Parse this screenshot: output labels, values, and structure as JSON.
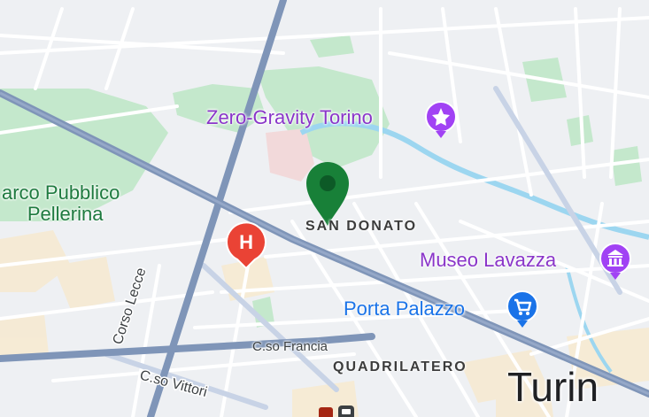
{
  "map": {
    "labels": {
      "park": "arco Pubblico\nPellerina",
      "park_line1": "arco Pubblico",
      "park_line2": "Pellerina",
      "zero_gravity": "Zero-Gravity Torino",
      "san_donato": "SAN DONATO",
      "museo": "Museo Lavazza",
      "porta": "Porta Palazzo",
      "corso_lecce": "Corso Lecce",
      "cso_francia": "C.so Francia",
      "quadrilatero": "QUADRILATERO",
      "cso_vittorio": "C.so Vittori",
      "turin": "Turin",
      "hospital_letter": "H"
    },
    "colors": {
      "land": "#eef0f3",
      "park": "#bfe6c6",
      "water": "#9cd6f0",
      "major_road": "#7f95b8",
      "road": "#ffffff",
      "purple_poi": "#a142f4",
      "blue_poi": "#1a73e8",
      "hospital": "#ea4335",
      "selected_pin": "#188038"
    },
    "icons": {
      "zero_gravity": "attraction-icon",
      "museo": "museum-icon",
      "porta": "shopping-cart-icon",
      "hospital": "hospital-icon",
      "selected": "location-pin-icon"
    }
  }
}
